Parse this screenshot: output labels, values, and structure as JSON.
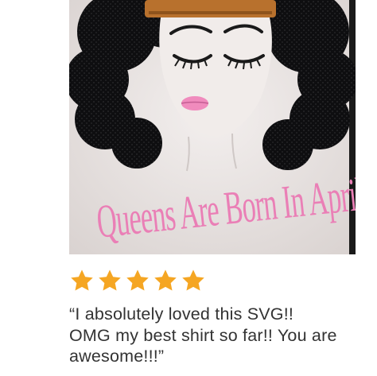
{
  "photo": {
    "shirt_text": "Queens Are Born In April",
    "colors": {
      "hair": "#0e0e10",
      "crown": "#b8712d",
      "lips": "#f08bbd",
      "lettering": "#ea7fb6",
      "shirt": "#ece7e5"
    }
  },
  "rating": {
    "stars": 5,
    "max": 5,
    "color": "#f5a623",
    "icon": "star-icon"
  },
  "review": {
    "line1": "“I absolutely loved this SVG!!",
    "line2": "OMG my best shirt so far!! You are",
    "line3": "awesome!!!”"
  }
}
